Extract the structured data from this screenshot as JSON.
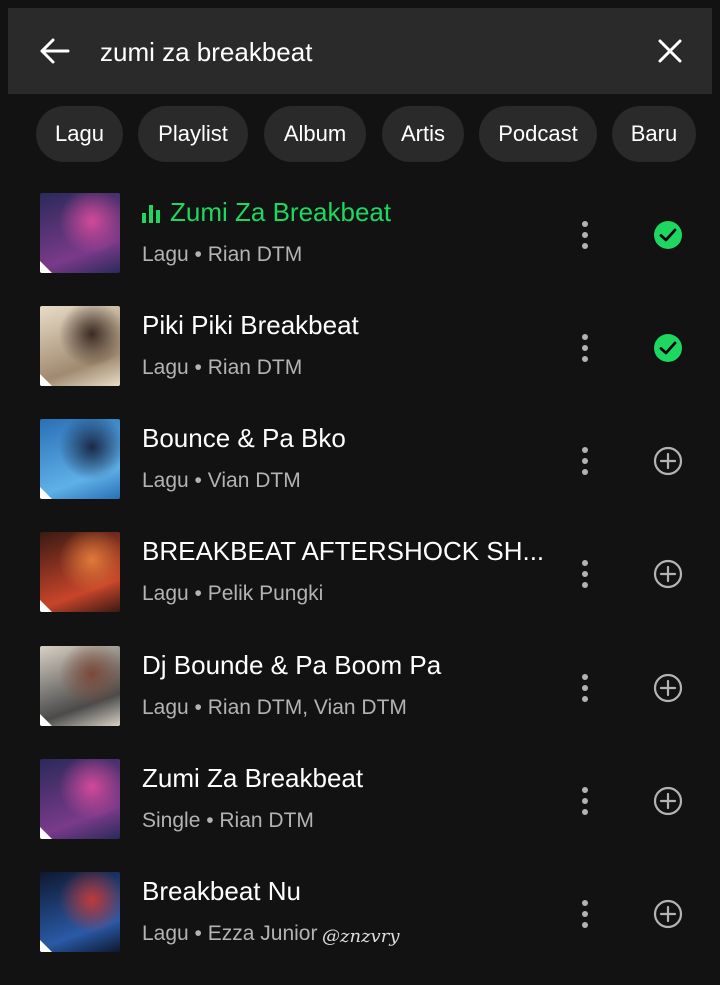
{
  "search": {
    "query": "zumi za breakbeat"
  },
  "filters": [
    {
      "label": "Lagu"
    },
    {
      "label": "Playlist"
    },
    {
      "label": "Album"
    },
    {
      "label": "Artis"
    },
    {
      "label": "Podcast"
    },
    {
      "label": "Baru"
    }
  ],
  "results": [
    {
      "title": "Zumi Za Breakbeat",
      "subtitle": "Lagu • Rian DTM",
      "playing": true,
      "status": "added",
      "cover_colors": [
        "#2b2a5a",
        "#7a3a8a",
        "#d14a9a"
      ]
    },
    {
      "title": "Piki Piki Breakbeat",
      "subtitle": "Lagu • Rian DTM",
      "playing": false,
      "status": "added",
      "cover_colors": [
        "#e8ddc8",
        "#a08a70",
        "#3a2a22"
      ]
    },
    {
      "title": "Bounce & Pa Bko",
      "subtitle": "Lagu • Vian DTM",
      "playing": false,
      "status": "add",
      "cover_colors": [
        "#2a6fb5",
        "#5fb0e8",
        "#1a2a48"
      ]
    },
    {
      "title": "BREAKBEAT AFTERSHOCK SH...",
      "subtitle": "Lagu • Pelik Pungki",
      "playing": false,
      "status": "add",
      "cover_colors": [
        "#3a1a14",
        "#c8452a",
        "#e07a3a"
      ]
    },
    {
      "title": "Dj Bounde & Pa Boom Pa",
      "subtitle": "Lagu • Rian DTM, Vian DTM",
      "playing": false,
      "status": "add",
      "cover_colors": [
        "#d8d0c4",
        "#4a4a4a",
        "#7a4a3a"
      ]
    },
    {
      "title": "Zumi Za Breakbeat",
      "subtitle": "Single • Rian DTM",
      "playing": false,
      "status": "add",
      "cover_colors": [
        "#2b2a5a",
        "#7a3a8a",
        "#d14a9a"
      ]
    },
    {
      "title": "Breakbeat Nu",
      "subtitle": "Lagu • Ezza Junior",
      "playing": false,
      "status": "add",
      "cover_colors": [
        "#0e1830",
        "#2a5aa8",
        "#c03a3a"
      ]
    }
  ],
  "watermark": "@znzvry",
  "colors": {
    "accent": "#1ed760",
    "background": "#121212",
    "surface": "#2a2a2a",
    "secondary_text": "#b3b3b3"
  },
  "icons": {
    "back": "arrow-left-icon",
    "clear": "close-icon",
    "more": "more-vertical-icon",
    "added": "check-circle-icon",
    "add": "add-circle-icon",
    "playing": "equalizer-icon"
  }
}
